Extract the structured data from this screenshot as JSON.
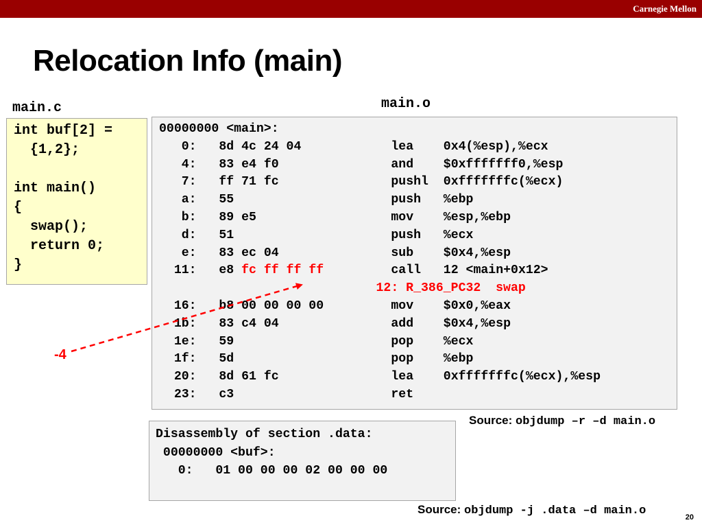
{
  "header": {
    "brand": "Carnegie Mellon"
  },
  "slide": {
    "title": "Relocation Info (main)",
    "page_number": "20"
  },
  "main_c": {
    "label": "main.c",
    "lines": [
      "int buf[2] =",
      "  {1,2};",
      "",
      "int main()",
      "{",
      "  swap();",
      "  return 0;",
      "}"
    ]
  },
  "main_o": {
    "label": "main.o",
    "header_line": "00000000 <main>:",
    "rows": [
      {
        "offset": "0:",
        "bytes": "8d 4c 24 04",
        "bytes_red": "",
        "mnemonic": "lea",
        "operands": "0x4(%esp),%ecx"
      },
      {
        "offset": "4:",
        "bytes": "83 e4 f0",
        "bytes_red": "",
        "mnemonic": "and",
        "operands": "$0xfffffff0,%esp"
      },
      {
        "offset": "7:",
        "bytes": "ff 71 fc",
        "bytes_red": "",
        "mnemonic": "pushl",
        "operands": "0xfffffffc(%ecx)"
      },
      {
        "offset": "a:",
        "bytes": "55",
        "bytes_red": "",
        "mnemonic": "push",
        "operands": "%ebp"
      },
      {
        "offset": "b:",
        "bytes": "89 e5",
        "bytes_red": "",
        "mnemonic": "mov",
        "operands": "%esp,%ebp"
      },
      {
        "offset": "d:",
        "bytes": "51",
        "bytes_red": "",
        "mnemonic": "push",
        "operands": "%ecx"
      },
      {
        "offset": "e:",
        "bytes": "83 ec 04",
        "bytes_red": "",
        "mnemonic": "sub",
        "operands": "$0x4,%esp"
      },
      {
        "offset": "11:",
        "bytes": "e8",
        "bytes_red": "fc ff ff ff",
        "mnemonic": "call",
        "operands": "12 <main+0x12>"
      },
      {
        "offset": "16:",
        "bytes": "b8 00 00 00 00",
        "bytes_red": "",
        "mnemonic": "mov",
        "operands": "$0x0,%eax"
      },
      {
        "offset": "1b:",
        "bytes": "83 c4 04",
        "bytes_red": "",
        "mnemonic": "add",
        "operands": "$0x4,%esp"
      },
      {
        "offset": "1e:",
        "bytes": "59",
        "bytes_red": "",
        "mnemonic": "pop",
        "operands": "%ecx"
      },
      {
        "offset": "1f:",
        "bytes": "5d",
        "bytes_red": "",
        "mnemonic": "pop",
        "operands": "%ebp"
      },
      {
        "offset": "20:",
        "bytes": "8d 61 fc",
        "bytes_red": "",
        "mnemonic": "lea",
        "operands": "0xfffffffc(%ecx),%esp"
      },
      {
        "offset": "23:",
        "bytes": "c3",
        "bytes_red": "",
        "mnemonic": "ret",
        "operands": ""
      }
    ],
    "relocation_entry": "12: R_386_PC32  swap",
    "relocation_after_row": 7,
    "source_label": "Source:",
    "source_command": "objdump –r –d main.o"
  },
  "data_section": {
    "line1": "Disassembly of section .data:",
    "line2": " 00000000 <buf>:",
    "line3": "   0:   01 00 00 00 02 00 00 00",
    "source_label": "Source:",
    "source_command": "objdump -j .data –d main.o"
  },
  "annotation": {
    "addend": "-4"
  },
  "colors": {
    "header_bar": "#990000",
    "code_box": "#ffffcc",
    "dump_box": "#f2f2f2",
    "highlight": "#ff0000"
  }
}
